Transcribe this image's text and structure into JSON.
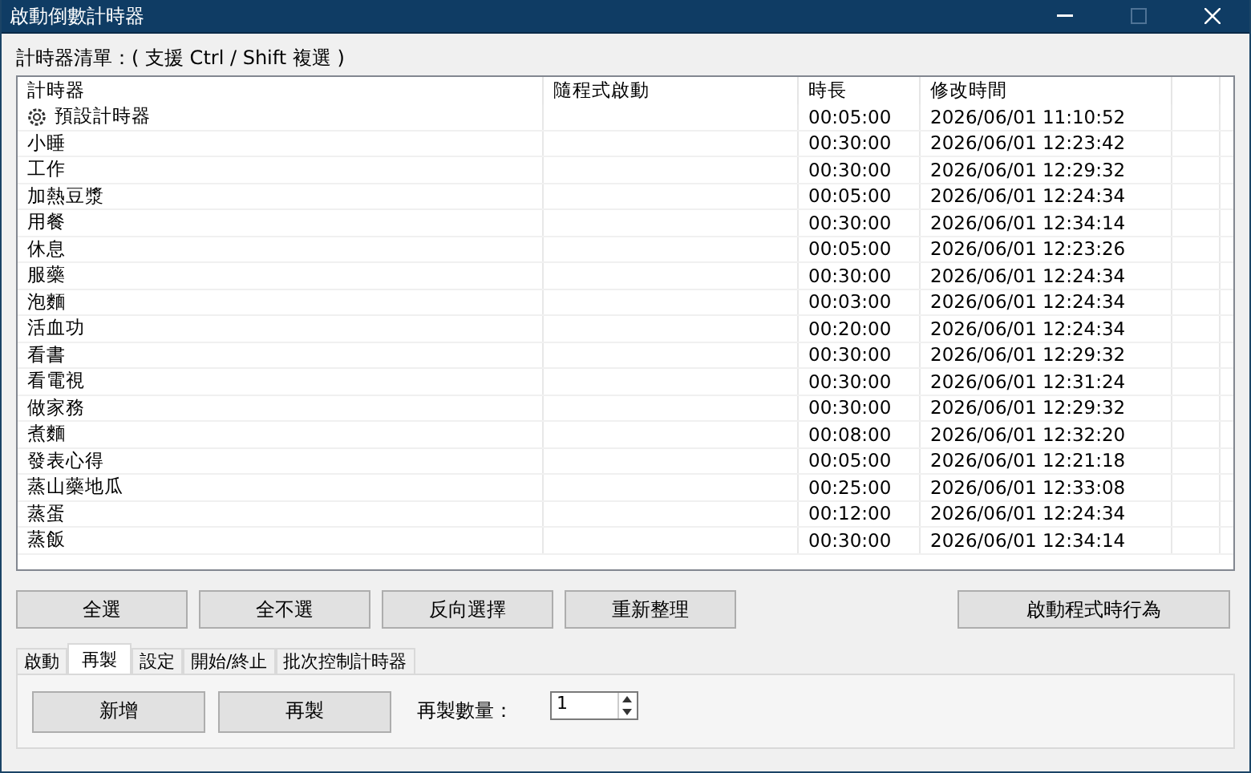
{
  "window": {
    "title": "啟動倒數計時器"
  },
  "list_label": "計時器清單：( 支援 Ctrl / Shift 複選 )",
  "table": {
    "columns": [
      "計時器",
      "隨程式啟動",
      "時長",
      "修改時間"
    ],
    "rows": [
      {
        "kind": "default",
        "name": "預設計時器",
        "duration": "00:05:00",
        "modified": "2026/06/01 11:10:52"
      },
      {
        "kind": "timer",
        "name": "小睡",
        "duration": "00:30:00",
        "modified": "2026/06/01 12:23:42"
      },
      {
        "kind": "timer",
        "name": "工作",
        "duration": "00:30:00",
        "modified": "2026/06/01 12:29:32"
      },
      {
        "kind": "timer",
        "name": "加熱豆漿",
        "duration": "00:05:00",
        "modified": "2026/06/01 12:24:34"
      },
      {
        "kind": "timer",
        "name": "用餐",
        "duration": "00:30:00",
        "modified": "2026/06/01 12:34:14"
      },
      {
        "kind": "timer",
        "name": "休息",
        "duration": "00:05:00",
        "modified": "2026/06/01 12:23:26"
      },
      {
        "kind": "timer",
        "name": "服藥",
        "duration": "00:30:00",
        "modified": "2026/06/01 12:24:34"
      },
      {
        "kind": "timer",
        "name": "泡麵",
        "duration": "00:03:00",
        "modified": "2026/06/01 12:24:34"
      },
      {
        "kind": "timer",
        "name": "活血功",
        "duration": "00:20:00",
        "modified": "2026/06/01 12:24:34"
      },
      {
        "kind": "timer",
        "name": "看書",
        "duration": "00:30:00",
        "modified": "2026/06/01 12:29:32"
      },
      {
        "kind": "timer",
        "name": "看電視",
        "duration": "00:30:00",
        "modified": "2026/06/01 12:31:24"
      },
      {
        "kind": "timer",
        "name": "做家務",
        "duration": "00:30:00",
        "modified": "2026/06/01 12:29:32"
      },
      {
        "kind": "timer",
        "name": "煮麵",
        "duration": "00:08:00",
        "modified": "2026/06/01 12:32:20"
      },
      {
        "kind": "timer",
        "name": "發表心得",
        "duration": "00:05:00",
        "modified": "2026/06/01 12:21:18"
      },
      {
        "kind": "timer",
        "name": "蒸山藥地瓜",
        "duration": "00:25:00",
        "modified": "2026/06/01 12:33:08"
      },
      {
        "kind": "timer",
        "name": "蒸蛋",
        "duration": "00:12:00",
        "modified": "2026/06/01 12:24:34"
      },
      {
        "kind": "timer",
        "name": "蒸飯",
        "duration": "00:30:00",
        "modified": "2026/06/01 12:34:14"
      }
    ]
  },
  "selection_buttons": [
    "全選",
    "全不選",
    "反向選擇",
    "重新整理"
  ],
  "startup_button": "啟動程式時行為",
  "tabs": [
    {
      "label": "啟動",
      "selected": false
    },
    {
      "label": "再製",
      "selected": true
    },
    {
      "label": "設定",
      "selected": false
    },
    {
      "label": "開始/終止",
      "selected": false
    },
    {
      "label": "批次控制計時器",
      "selected": false
    }
  ],
  "duplicate_panel": {
    "buttons": [
      "新增",
      "再製"
    ],
    "count_label": "再製數量：",
    "count_value": "1"
  }
}
